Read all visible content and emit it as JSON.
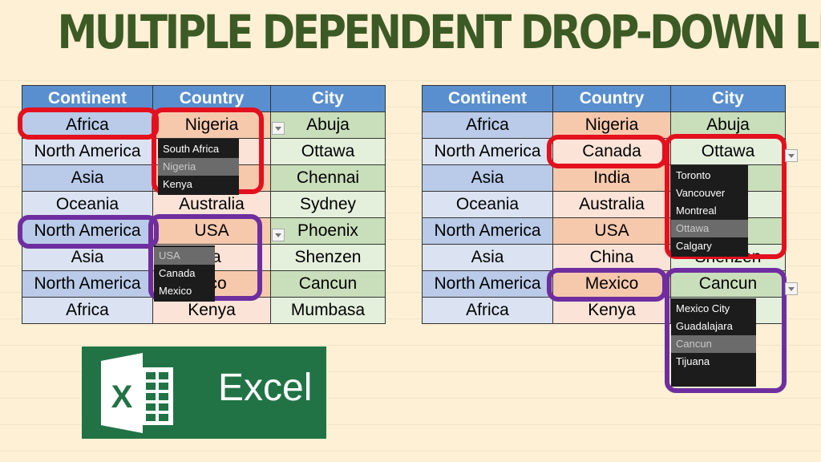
{
  "title": "MULTIPLE DEPENDENT DROP-DOWN LIST",
  "headers": [
    "Continent",
    "Country",
    "City"
  ],
  "left_table": {
    "rows": [
      [
        "Africa",
        "Nigeria",
        "Abuja"
      ],
      [
        "North America",
        "",
        "Ottawa"
      ],
      [
        "Asia",
        "",
        "Chennai"
      ],
      [
        "Oceania",
        "Australia",
        "Sydney"
      ],
      [
        "North America",
        "USA",
        "Phoenix"
      ],
      [
        "Asia",
        "na",
        "Shenzen"
      ],
      [
        "North America",
        "xico",
        "Cancun"
      ],
      [
        "Africa",
        "Kenya",
        "Mumbasa"
      ]
    ],
    "dropdown_1": {
      "items": [
        "South Africa",
        "Nigeria",
        "Kenya"
      ],
      "selected": "Nigeria"
    },
    "dropdown_2": {
      "items": [
        "USA",
        "Canada",
        "Mexico"
      ],
      "selected": "USA"
    }
  },
  "right_table": {
    "rows": [
      [
        "Africa",
        "Nigeria",
        "Abuja"
      ],
      [
        "North America",
        "Canada",
        "Ottawa"
      ],
      [
        "Asia",
        "India",
        "ai"
      ],
      [
        "Oceania",
        "Australia",
        "y"
      ],
      [
        "North America",
        "USA",
        "ix"
      ],
      [
        "Asia",
        "China",
        "Shenzen"
      ],
      [
        "North America",
        "Mexico",
        "Cancun"
      ],
      [
        "Africa",
        "Kenya",
        "sa"
      ]
    ],
    "dropdown_1": {
      "items": [
        "Toronto",
        "Vancouver",
        "Montreal",
        "Ottawa",
        "Calgary"
      ],
      "selected": "Ottawa"
    },
    "dropdown_2": {
      "items": [
        "Mexico City",
        "Guadalajara",
        "Cancun",
        "Tijuana"
      ],
      "selected": "Cancun"
    }
  },
  "logo": {
    "text": "Excel",
    "letter": "X",
    "color": "#217346"
  },
  "colors": {
    "title": "#3c5a25",
    "header": "#5a8fcf",
    "red_highlight": "#e3101e",
    "purple_highlight": "#6e2e9f"
  }
}
